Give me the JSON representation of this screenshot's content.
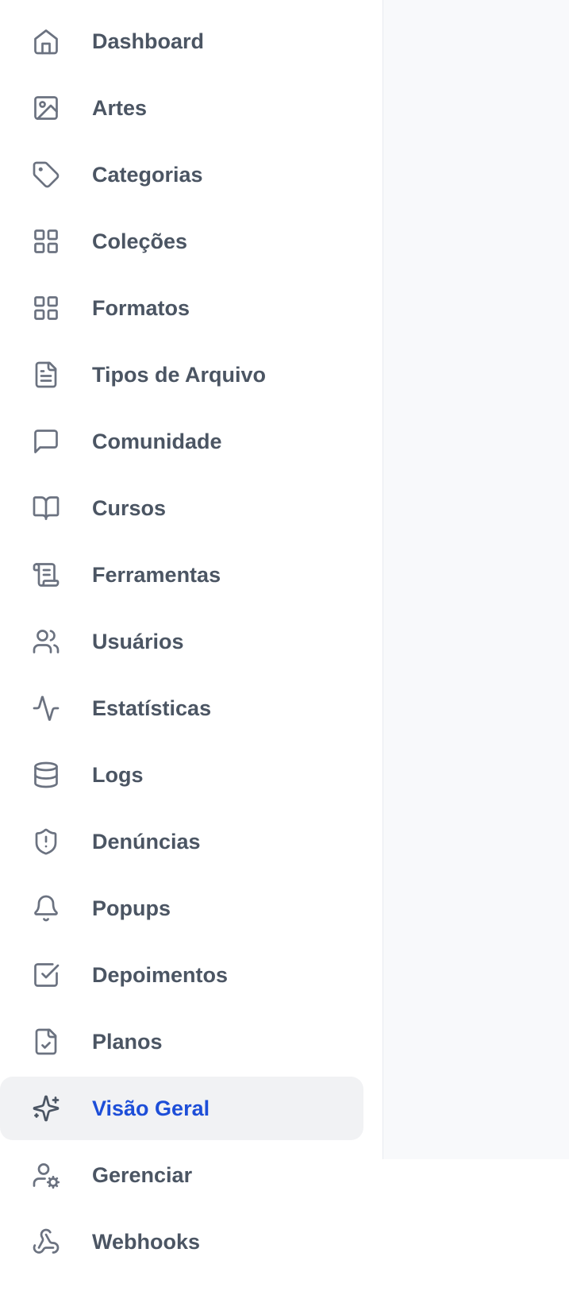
{
  "sidebar": {
    "active_color": "#1d4ed8",
    "items": [
      {
        "label": "Dashboard",
        "icon": "home-icon"
      },
      {
        "label": "Artes",
        "icon": "image-icon"
      },
      {
        "label": "Categorias",
        "icon": "tag-icon"
      },
      {
        "label": "Coleções",
        "icon": "grid-icon"
      },
      {
        "label": "Formatos",
        "icon": "grid-icon"
      },
      {
        "label": "Tipos de Arquivo",
        "icon": "file-text-icon"
      },
      {
        "label": "Comunidade",
        "icon": "message-square-icon"
      },
      {
        "label": "Cursos",
        "icon": "book-open-icon"
      },
      {
        "label": "Ferramentas",
        "icon": "scroll-icon"
      },
      {
        "label": "Usuários",
        "icon": "users-icon"
      },
      {
        "label": "Estatísticas",
        "icon": "activity-icon"
      },
      {
        "label": "Logs",
        "icon": "database-icon"
      },
      {
        "label": "Denúncias",
        "icon": "shield-alert-icon"
      },
      {
        "label": "Popups",
        "icon": "bell-icon"
      },
      {
        "label": "Depoimentos",
        "icon": "check-square-icon"
      },
      {
        "label": "Planos",
        "icon": "file-check-icon"
      },
      {
        "label": "Visão Geral",
        "icon": "sparkles-icon",
        "active": true
      },
      {
        "label": "Gerenciar",
        "icon": "user-cog-icon"
      },
      {
        "label": "Webhooks",
        "icon": "webhook-icon"
      }
    ]
  }
}
